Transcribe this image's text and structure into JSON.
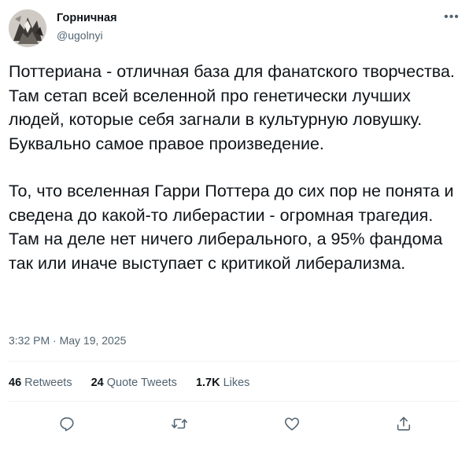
{
  "author": {
    "display_name": "Горничная",
    "handle": "@ugolnyi",
    "avatar_icon": "avatar-photo"
  },
  "tweet": {
    "paragraphs": [
      "Поттериана - отличная база для фанатского творчества. Там сетап всей вселенной про генетически лучших людей, которые себя загнали в культурную ловушку. Буквально самое правое произведение.",
      "То, что вселенная Гарри Поттера до сих пор не понята и сведена до какой-то либерастии - огромная трагедия. Там на деле нет ничего либерального, а 95% фандома так или иначе выступает с критикой либерализма."
    ],
    "timestamp": "3:32 PM · May 19, 2025"
  },
  "stats": [
    {
      "count": "46",
      "label": "Retweets"
    },
    {
      "count": "24",
      "label": "Quote Tweets"
    },
    {
      "count": "1.7K",
      "label": "Likes"
    }
  ],
  "actions": [
    "reply-icon",
    "retweet-icon",
    "like-icon",
    "share-icon"
  ],
  "colors": {
    "text": "#0f1419",
    "secondary": "#536471",
    "divider": "#eff3f4"
  }
}
